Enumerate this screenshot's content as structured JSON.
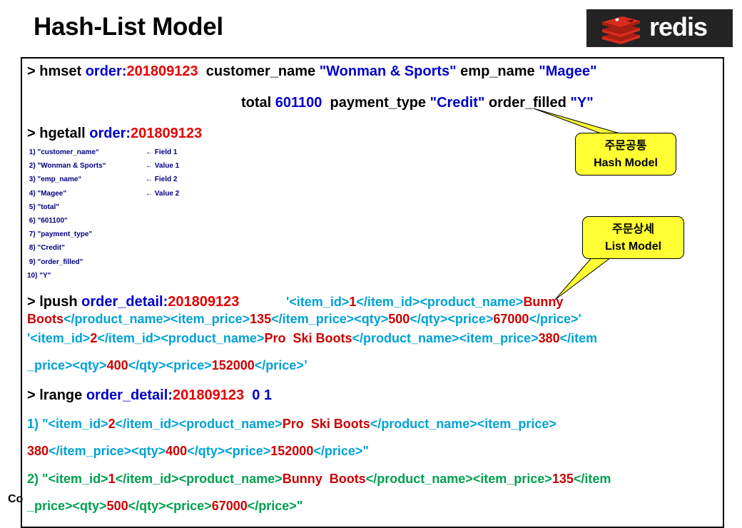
{
  "title": "Hash-List Model",
  "logo": {
    "text": "redis"
  },
  "footer_fragment": "Co",
  "commands": {
    "hmset_l1": {
      "a": "> hmset ",
      "b": "order:",
      "c": "201809123",
      "d": "  customer_name ",
      "e": "\"Wonman & Sports\"",
      "f": " emp_name ",
      "g": "\"Magee\""
    },
    "hmset_l2": {
      "a": "total ",
      "b": "601100",
      "c": "  payment_type ",
      "d": "\"Credit\"",
      "e": " order_filled ",
      "f": "\"Y\""
    },
    "hgetall": {
      "a": "> hgetall ",
      "b": "order:",
      "c": "201809123"
    },
    "lpush": {
      "a": "> lpush ",
      "b": "order_detail:",
      "c": "201809123"
    },
    "lrange": {
      "a": "> lrange ",
      "b": "order_detail:",
      "c": "201809123",
      "d": "  0 1"
    }
  },
  "hgetall_results": [
    {
      "text": " 1) \"customer_name“",
      "note": "← Field 1"
    },
    {
      "text": " 2) \"Wonman & Sports“",
      "note": "← Value 1"
    },
    {
      "text": " 3) \"emp_name“",
      "note": "← Field 2"
    },
    {
      "text": " 4) \"Magee\"",
      "note": "← Value 2"
    },
    {
      "text": " 5) \"total\"",
      "note": ""
    },
    {
      "text": " 6) \"601100\"",
      "note": ""
    },
    {
      "text": " 7) \"payment_type\"",
      "note": ""
    },
    {
      "text": " 8) \"Credit\"",
      "note": ""
    },
    {
      "text": " 9) \"order_filled\"",
      "note": ""
    },
    {
      "text": "10) \"Y\"",
      "note": ""
    }
  ],
  "lpush_lines": [
    [
      [
        "cy",
        "'<item_id>"
      ],
      [
        "rd2",
        "1"
      ],
      [
        "cy",
        "</item_id><product_name>"
      ],
      [
        "rd2",
        "Bunny"
      ]
    ],
    [
      [
        "rd2",
        "Boots"
      ],
      [
        "cy",
        "</product_name><item_price>"
      ],
      [
        "rd2",
        "135"
      ],
      [
        "cy",
        "</item_price><qty>"
      ],
      [
        "rd2",
        "500"
      ],
      [
        "cy",
        "</qty><price>"
      ],
      [
        "rd2",
        "67000"
      ],
      [
        "cy",
        "</price>'"
      ]
    ],
    [
      [
        "cy",
        "'<item_id>"
      ],
      [
        "rd2",
        "2"
      ],
      [
        "cy",
        "</item_id><product_name>"
      ],
      [
        "rd2",
        "Pro  Ski Boots"
      ],
      [
        "cy",
        "</product_name><item_price>"
      ],
      [
        "rd2",
        "380"
      ],
      [
        "cy",
        "</item"
      ]
    ],
    [
      [
        "cy",
        "_price><qty>"
      ],
      [
        "rd2",
        "400"
      ],
      [
        "cy",
        "</qty><price>"
      ],
      [
        "rd2",
        "152000"
      ],
      [
        "cy",
        "</price>’"
      ]
    ]
  ],
  "lrange_lines": [
    [
      [
        "cy",
        "1) \"<item_id>"
      ],
      [
        "rd2",
        "2"
      ],
      [
        "cy",
        "</item_id><product_name>"
      ],
      [
        "rd2",
        "Pro  Ski Boots"
      ],
      [
        "cy",
        "</product_name><item_price>"
      ]
    ],
    [
      [
        "rd2",
        "380"
      ],
      [
        "cy",
        "</item_price><qty>"
      ],
      [
        "rd2",
        "400"
      ],
      [
        "cy",
        "</qty><price>"
      ],
      [
        "rd2",
        "152000"
      ],
      [
        "cy",
        "</price>\""
      ]
    ],
    [
      [
        "grn",
        "2) \"<item_id>"
      ],
      [
        "rd2",
        "1"
      ],
      [
        "grn",
        "</item_id><product_name>"
      ],
      [
        "rd2",
        "Bunny  Boots"
      ],
      [
        "grn",
        "</product_name><item_price>"
      ],
      [
        "rd2",
        "135"
      ],
      [
        "grn",
        "</item"
      ]
    ],
    [
      [
        "grn",
        "_price><qty>"
      ],
      [
        "rd2",
        "500"
      ],
      [
        "grn",
        "</qty><price>"
      ],
      [
        "rd2",
        "67000"
      ],
      [
        "grn",
        "</price>\""
      ]
    ]
  ],
  "callouts": {
    "hash": {
      "line1": "주문공통",
      "line2": "Hash Model"
    },
    "list": {
      "line1": "주문상세",
      "line2": "List Model"
    }
  },
  "colors": {
    "callout": "#ffff33",
    "logo_bg": "#232323",
    "logo_red": "#d82c20"
  }
}
